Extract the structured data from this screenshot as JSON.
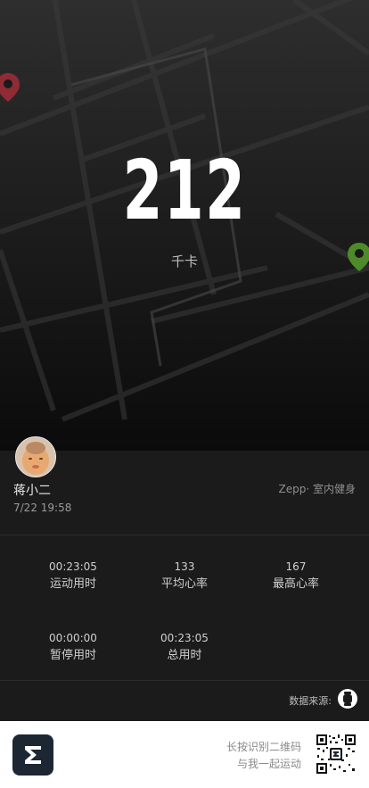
{
  "workout": {
    "calories_value": "212",
    "calories_unit": "千卡"
  },
  "profile": {
    "username": "蒋小二",
    "datetime": "7/22 19:58",
    "source_tag": "Zepp· 室内健身"
  },
  "stats": [
    {
      "value": "00:23:05",
      "label": "运动用时"
    },
    {
      "value": "133",
      "label": "平均心率"
    },
    {
      "value": "167",
      "label": "最高心率"
    },
    {
      "value": "00:00:00",
      "label": "暂停用时"
    },
    {
      "value": "00:23:05",
      "label": "总用时"
    }
  ],
  "data_source_label": "数据来源:",
  "footer": {
    "line1": "长按识别二维码",
    "line2": "与我一起运动"
  },
  "colors": {
    "pin_start": "#8e2b34",
    "pin_end": "#4e8a2a",
    "background": "#1b1b1b"
  }
}
